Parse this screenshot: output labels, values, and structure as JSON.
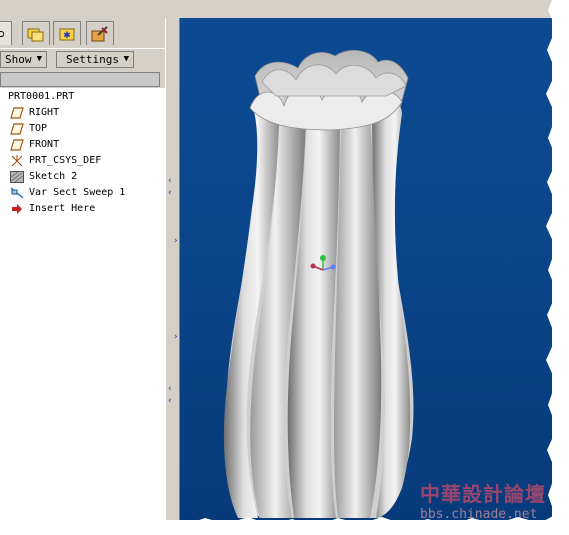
{
  "model_tree": {
    "tabs": [
      {
        "icon": "model-tree-icon"
      },
      {
        "icon": "folder-browser-icon"
      },
      {
        "icon": "favorites-icon"
      },
      {
        "icon": "connections-icon"
      }
    ],
    "menus": {
      "show_label": "Show",
      "settings_label": "Settings"
    },
    "items": [
      {
        "label": "PRT0001.PRT",
        "icon": "part-icon"
      },
      {
        "label": "RIGHT",
        "icon": "datum-plane-icon"
      },
      {
        "label": "TOP",
        "icon": "datum-plane-icon"
      },
      {
        "label": "FRONT",
        "icon": "datum-plane-icon"
      },
      {
        "label": "PRT_CSYS_DEF",
        "icon": "coordinate-system-icon"
      },
      {
        "label": "Sketch 2",
        "icon": "sketch-icon"
      },
      {
        "label": "Var Sect Sweep 1",
        "icon": "sweep-icon"
      },
      {
        "label": "Insert Here",
        "icon": "insert-arrow-icon"
      }
    ]
  },
  "viewport": {
    "background_top": "#0d4a92",
    "background_bottom": "#073a7a",
    "model": "vase-model",
    "triad_colors": {
      "x": "#c0304a",
      "y": "#30c040",
      "z": "#6080ff"
    }
  },
  "watermark": {
    "cn_text": "中華設計論壇",
    "url_text": "bbs.chinade.net"
  }
}
